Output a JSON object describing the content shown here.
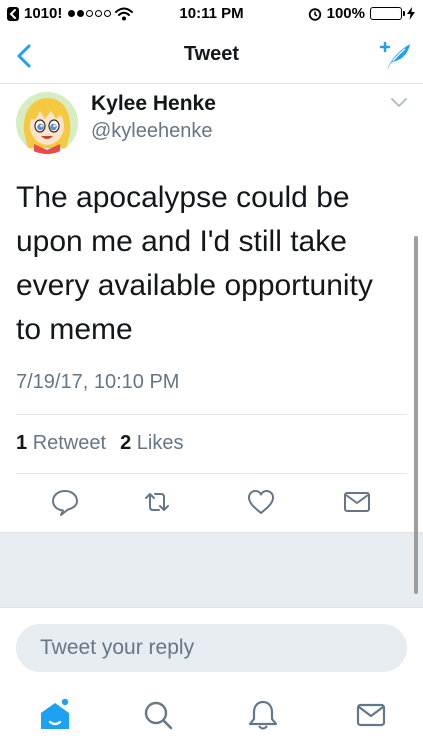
{
  "status_bar": {
    "back_app": "1010!",
    "time": "10:11 PM",
    "battery": "100%",
    "signal_bars": 2
  },
  "nav": {
    "title": "Tweet",
    "back_icon": "chevron-left-icon",
    "compose_icon": "compose-tweet-icon"
  },
  "tweet": {
    "author_name": "Kylee Henke",
    "author_handle": "@kyleehenke",
    "text": "The apocalypse could be upon me and I'd still take every available opportunity to meme",
    "timestamp": "7/19/17, 10:10 PM",
    "retweet_count": "1",
    "retweet_label": "Retweet",
    "like_count": "2",
    "like_label": "Likes"
  },
  "actions": [
    "reply-icon",
    "retweet-icon",
    "like-icon",
    "direct-message-icon"
  ],
  "reply": {
    "placeholder": "Tweet your reply"
  },
  "tab_bar": [
    "home-icon",
    "search-icon",
    "notifications-icon",
    "messages-icon"
  ],
  "colors": {
    "accent": "#1da1f2",
    "secondary_text": "#657786",
    "primary_text": "#14171a",
    "divider": "#e1e8ed"
  }
}
